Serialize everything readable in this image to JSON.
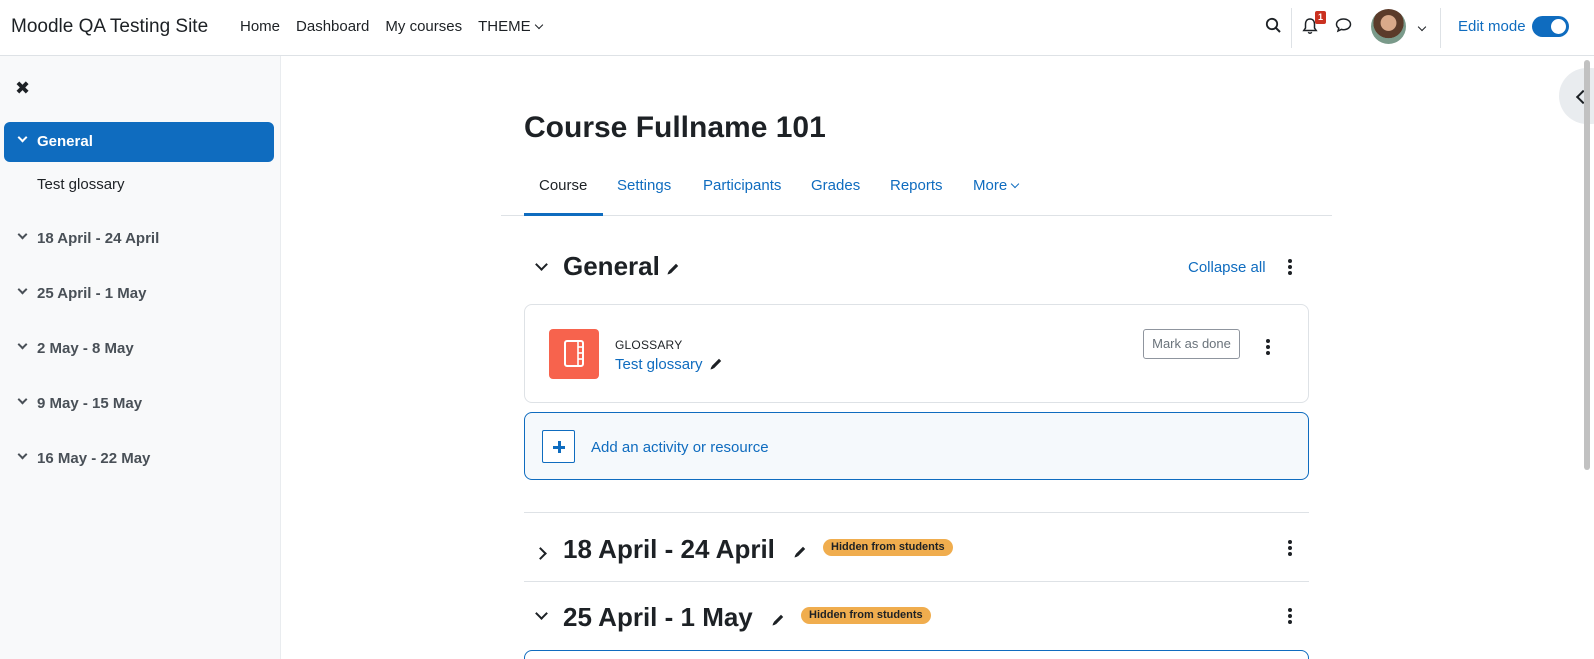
{
  "site_name": "Moodle QA Testing Site",
  "primary_nav": {
    "home": "Home",
    "dashboard": "Dashboard",
    "my_courses": "My courses",
    "theme": "THEME"
  },
  "user_menu": {
    "notification_count": "1",
    "edit_mode_label": "Edit mode",
    "edit_mode_on": true
  },
  "course_index": {
    "items": [
      {
        "label": "General",
        "active": true
      },
      {
        "label": "18 April - 24 April"
      },
      {
        "label": "25 April - 1 May"
      },
      {
        "label": "2 May - 8 May"
      },
      {
        "label": "9 May - 15 May"
      },
      {
        "label": "16 May - 22 May"
      }
    ],
    "general_activity": "Test glossary"
  },
  "course": {
    "title": "Course Fullname 101",
    "tabs": [
      "Course",
      "Settings",
      "Participants",
      "Grades",
      "Reports",
      "More"
    ],
    "active_tab": "Course"
  },
  "sections": {
    "general": {
      "title": "General",
      "collapse_all": "Collapse all",
      "activity": {
        "type": "GLOSSARY",
        "name": "Test glossary",
        "mark_done": "Mark as done"
      },
      "add_activity": "Add an activity or resource"
    },
    "week1": {
      "title": "18 April - 24 April",
      "badge": "Hidden from students",
      "collapsed": true
    },
    "week2": {
      "title": "25 April - 1 May",
      "badge": "Hidden from students",
      "collapsed": false
    }
  },
  "colors": {
    "primary": "#0f6cbf",
    "glossary_icon": "#f7634d",
    "hidden_badge": "#f0ad4e",
    "notification_badge": "#ca3120"
  }
}
